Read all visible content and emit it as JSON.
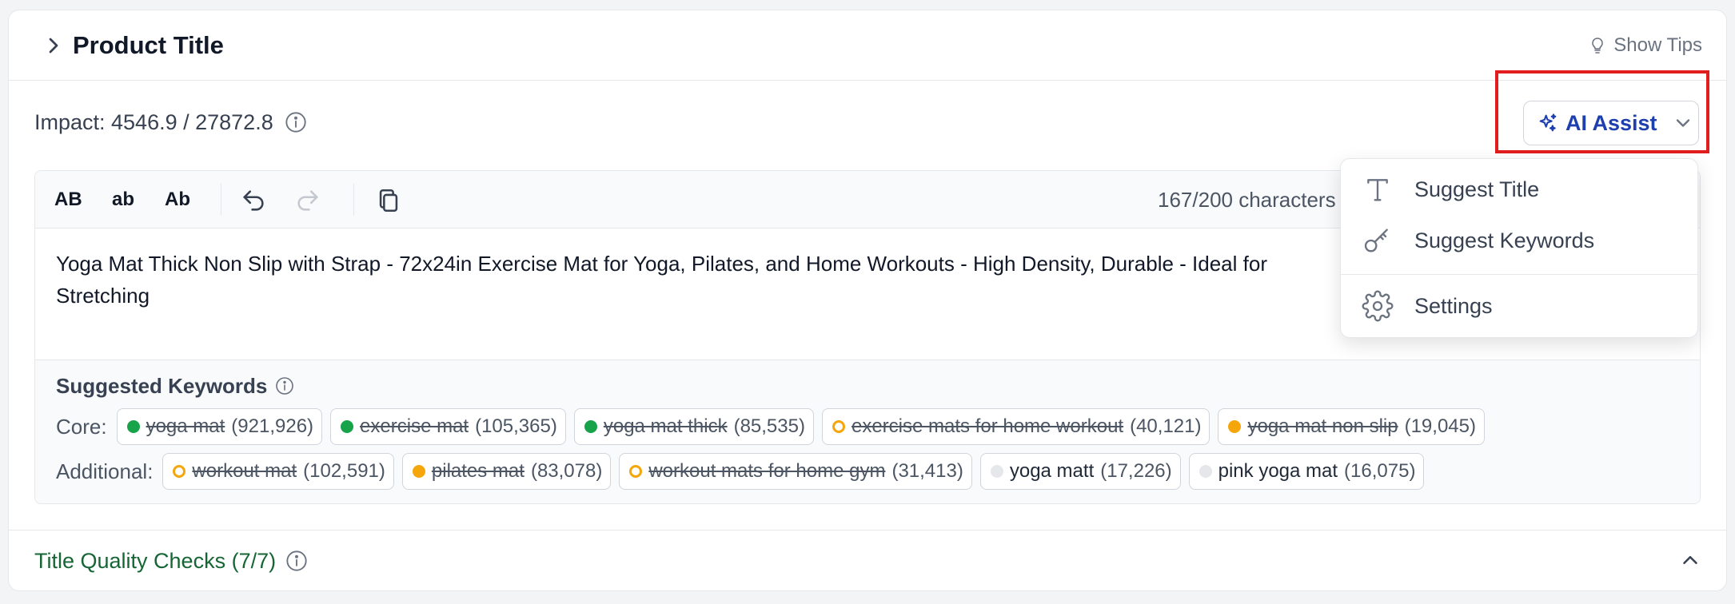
{
  "header": {
    "title": "Product Title",
    "tips_label": "Show Tips"
  },
  "impact": {
    "label": "Impact: 4546.9 / 27872.8"
  },
  "ai_assist": {
    "label": "AI Assist"
  },
  "toolbar": {
    "upper": "AB",
    "lower": "ab",
    "title_case": "Ab",
    "char_count": "167/200 characters"
  },
  "editor": {
    "text": "Yoga Mat Thick Non Slip with Strap - 72x24in Exercise Mat for Yoga, Pilates, and Home Workouts - High Density, Durable - Ideal for\nStretching"
  },
  "keywords": {
    "title": "Suggested Keywords",
    "core_label": "Core:",
    "additional_label": "Additional:",
    "core": [
      {
        "term": "yoga mat",
        "count": "(921,926)",
        "status": "green",
        "used": true
      },
      {
        "term": "exercise mat",
        "count": "(105,365)",
        "status": "green",
        "used": true
      },
      {
        "term": "yoga mat thick",
        "count": "(85,535)",
        "status": "green",
        "used": true
      },
      {
        "term": "exercise mats for home workout",
        "count": "(40,121)",
        "status": "ring",
        "used": true
      },
      {
        "term": "yoga mat non slip",
        "count": "(19,045)",
        "status": "amber",
        "used": true
      }
    ],
    "additional": [
      {
        "term": "workout mat",
        "count": "(102,591)",
        "status": "ring",
        "used": true
      },
      {
        "term": "pilates mat",
        "count": "(83,078)",
        "status": "amber",
        "used": true
      },
      {
        "term": "workout mats for home gym",
        "count": "(31,413)",
        "status": "ring",
        "used": true
      },
      {
        "term": "yoga matt",
        "count": "(17,226)",
        "status": "gray",
        "used": false
      },
      {
        "term": "pink yoga mat",
        "count": "(16,075)",
        "status": "gray",
        "used": false
      }
    ]
  },
  "quality": {
    "label": "Title Quality Checks (7/7)"
  },
  "menu": {
    "items": [
      {
        "label": "Suggest Title",
        "icon": "text-icon"
      },
      {
        "label": "Suggest Keywords",
        "icon": "key-icon"
      },
      {
        "label": "Settings",
        "icon": "gear-icon"
      }
    ]
  },
  "colors": {
    "accent": "#1e40af",
    "success": "#166534",
    "highlight": "#e11d1d"
  }
}
